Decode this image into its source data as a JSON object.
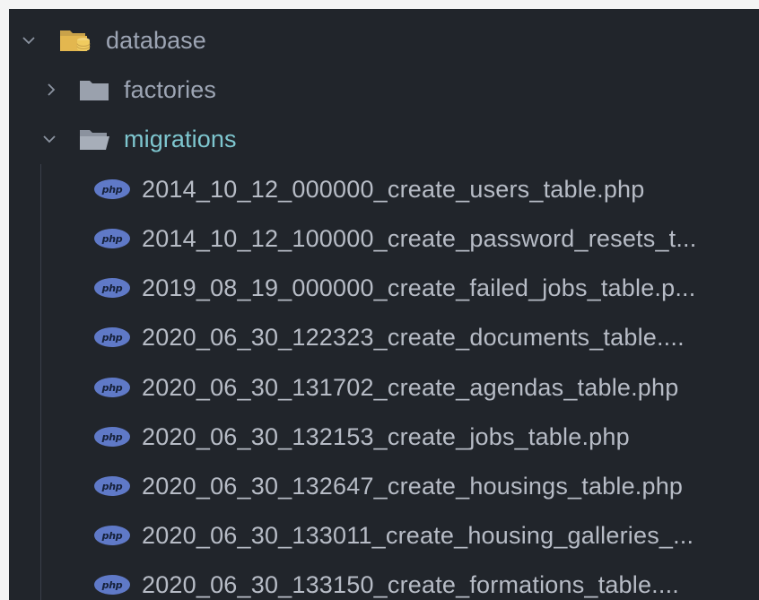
{
  "tree": {
    "database": {
      "label": "database",
      "expanded": true,
      "icon": "folder-open-database-icon"
    },
    "factories": {
      "label": "factories",
      "expanded": false,
      "icon": "folder-closed-icon"
    },
    "migrations": {
      "label": "migrations",
      "expanded": true,
      "icon": "folder-open-icon"
    },
    "files": [
      {
        "label": "2014_10_12_000000_create_users_table.php",
        "icon": "php-icon"
      },
      {
        "label": "2014_10_12_100000_create_password_resets_t...",
        "icon": "php-icon"
      },
      {
        "label": "2019_08_19_000000_create_failed_jobs_table.p...",
        "icon": "php-icon"
      },
      {
        "label": "2020_06_30_122323_create_documents_table....",
        "icon": "php-icon"
      },
      {
        "label": "2020_06_30_131702_create_agendas_table.php",
        "icon": "php-icon"
      },
      {
        "label": "2020_06_30_132153_create_jobs_table.php",
        "icon": "php-icon"
      },
      {
        "label": "2020_06_30_132647_create_housings_table.php",
        "icon": "php-icon"
      },
      {
        "label": "2020_06_30_133011_create_housing_galleries_...",
        "icon": "php-icon"
      },
      {
        "label": "2020_06_30_133150_create_formations_table....",
        "icon": "php-icon"
      }
    ],
    "php_badge_text": "php"
  },
  "colors": {
    "background": "#21252b",
    "text": "#9da5b4",
    "active_folder": "#7ec6cf",
    "php_badge": "#5f79c7"
  }
}
